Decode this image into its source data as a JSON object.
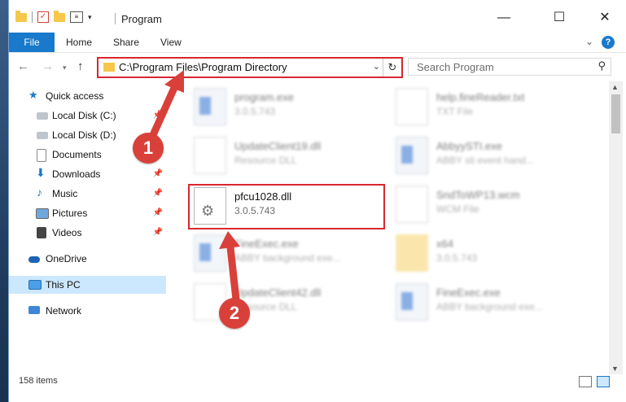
{
  "window": {
    "title": "Program",
    "min": "—",
    "max": "☐",
    "close": "✕"
  },
  "ribbon": {
    "tabs": [
      "File",
      "Home",
      "Share",
      "View"
    ],
    "help": "?"
  },
  "address": {
    "path": "C:\\Program Files\\Program Directory",
    "search_placeholder": "Search Program"
  },
  "sidebar": {
    "items": [
      {
        "label": "Quick access"
      },
      {
        "label": "Local Disk (C:)"
      },
      {
        "label": "Local Disk (D:)"
      },
      {
        "label": "Documents"
      },
      {
        "label": "Downloads"
      },
      {
        "label": "Music"
      },
      {
        "label": "Pictures"
      },
      {
        "label": "Videos"
      },
      {
        "label": "OneDrive"
      },
      {
        "label": "This PC"
      },
      {
        "label": "Network"
      }
    ]
  },
  "files": [
    {
      "name": "program.exe",
      "sub": "3.0.5.743",
      "icon": "exe-icon"
    },
    {
      "name": "help.fineReader.txt",
      "sub": "TXT File",
      "icon": "txt-icon"
    },
    {
      "name": "UpdateClient19.dll",
      "sub": "Resource DLL",
      "icon": "dll-icon"
    },
    {
      "name": "AbbyySTI.exe",
      "sub": "ABBY sti event hand...",
      "icon": "exe-icon"
    },
    {
      "name": "pfcu1028.dll",
      "sub": "3.0.5.743",
      "icon": "dll-icon"
    },
    {
      "name": "SndToWP13.wcm",
      "sub": "WCM File",
      "icon": "file-icon"
    },
    {
      "name": "FineExec.exe",
      "sub": "ABBY background exe...",
      "icon": "exe-icon"
    },
    {
      "name": "x64",
      "sub": "3.0.5.743",
      "icon": "folder-icon"
    },
    {
      "name": "UpdateClient42.dll",
      "sub": "Resource DLL",
      "icon": "dll-icon"
    },
    {
      "name": "FineExec.exe",
      "sub": "ABBY background exe...",
      "icon": "exe-icon"
    }
  ],
  "status": {
    "count": "158 items"
  },
  "annotations": {
    "step1": "1",
    "step2": "2",
    "color": "#d9403a"
  }
}
